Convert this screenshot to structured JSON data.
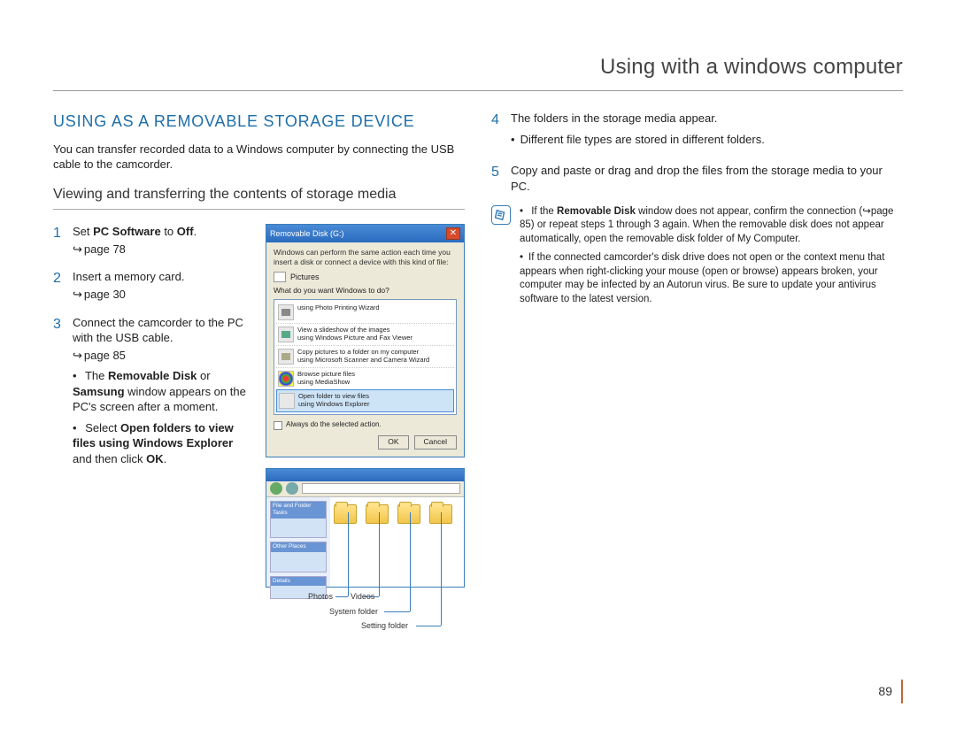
{
  "header": {
    "title": "Using with a windows computer"
  },
  "left": {
    "heading": "USING AS A REMOVABLE STORAGE DEVICE",
    "intro": "You can transfer recorded data to a Windows computer by connecting the USB cable to the camcorder.",
    "subheading": "Viewing and transferring the contents of storage media",
    "steps": {
      "s1": {
        "num": "1",
        "pre": "Set ",
        "bold1": "PC Software",
        "mid": " to ",
        "bold2": "Off",
        "post": ".",
        "page": "page 78"
      },
      "s2": {
        "num": "2",
        "text": "Insert a memory card.",
        "page": "page 30"
      },
      "s3": {
        "num": "3",
        "text": "Connect the camcorder to the PC with the USB cable.",
        "page": "page 85",
        "b1": {
          "a": "The ",
          "b": "Removable Disk",
          "c": " or ",
          "d": "Samsung",
          "e": " window appears on the PC's screen after a moment."
        },
        "b2": {
          "a": "Select ",
          "b": "Open folders to view files using Windows Explorer",
          "c": " and then click ",
          "d": "OK",
          "e": "."
        }
      }
    },
    "fig1": {
      "title": "Removable Disk (G:)",
      "msg": "Windows can perform the same action each time you insert a disk or connect a device with this kind of file:",
      "cat": "Pictures",
      "q": "What do you want Windows to do?",
      "opts": {
        "o1": {
          "t": "using Photo Printing Wizard",
          "s": ""
        },
        "o2": {
          "t": "View a slideshow of the images",
          "s": "using Windows Picture and Fax Viewer"
        },
        "o3": {
          "t": "Copy pictures to a folder on my computer",
          "s": "using Microsoft Scanner and Camera Wizard"
        },
        "o4": {
          "t": "Browse picture files",
          "s": "using MediaShow"
        },
        "o5": {
          "t": "Open folder to view files",
          "s": "using Windows Explorer"
        }
      },
      "chk": "Always do the selected action.",
      "ok": "OK",
      "cancel": "Cancel"
    },
    "fig2": {
      "addr": "",
      "sidepanel1": "File and Folder Tasks",
      "sidepanel2": "Other Places",
      "sidepanel3": "Details",
      "folders": {
        "f1": "",
        "f2": "",
        "f3": "",
        "f4": ""
      },
      "callouts": {
        "c1": "Photos",
        "c2": "Videos",
        "c3": "System folder",
        "c4": "Setting folder"
      }
    }
  },
  "right": {
    "steps": {
      "s4": {
        "num": "4",
        "text": "The folders in the storage media appear.",
        "b1": "Different file types are stored in different folders."
      },
      "s5": {
        "num": "5",
        "text": "Copy and paste or drag and drop the files from the storage media to your PC."
      }
    },
    "notes": {
      "n1": {
        "a": "If the ",
        "b": "Removable Disk",
        "c": " window does not appear, confirm the connection (↪page 85) or repeat steps 1 through 3 again. When the removable disk does not appear automatically, open the removable disk folder of My Computer."
      },
      "n2": "If the connected camcorder's disk drive does not open or the context menu that appears when right-clicking your mouse (open or browse) appears broken, your computer may be infected by an Autorun virus. Be sure to update your antivirus software to the latest version."
    }
  },
  "pageNumber": "89"
}
